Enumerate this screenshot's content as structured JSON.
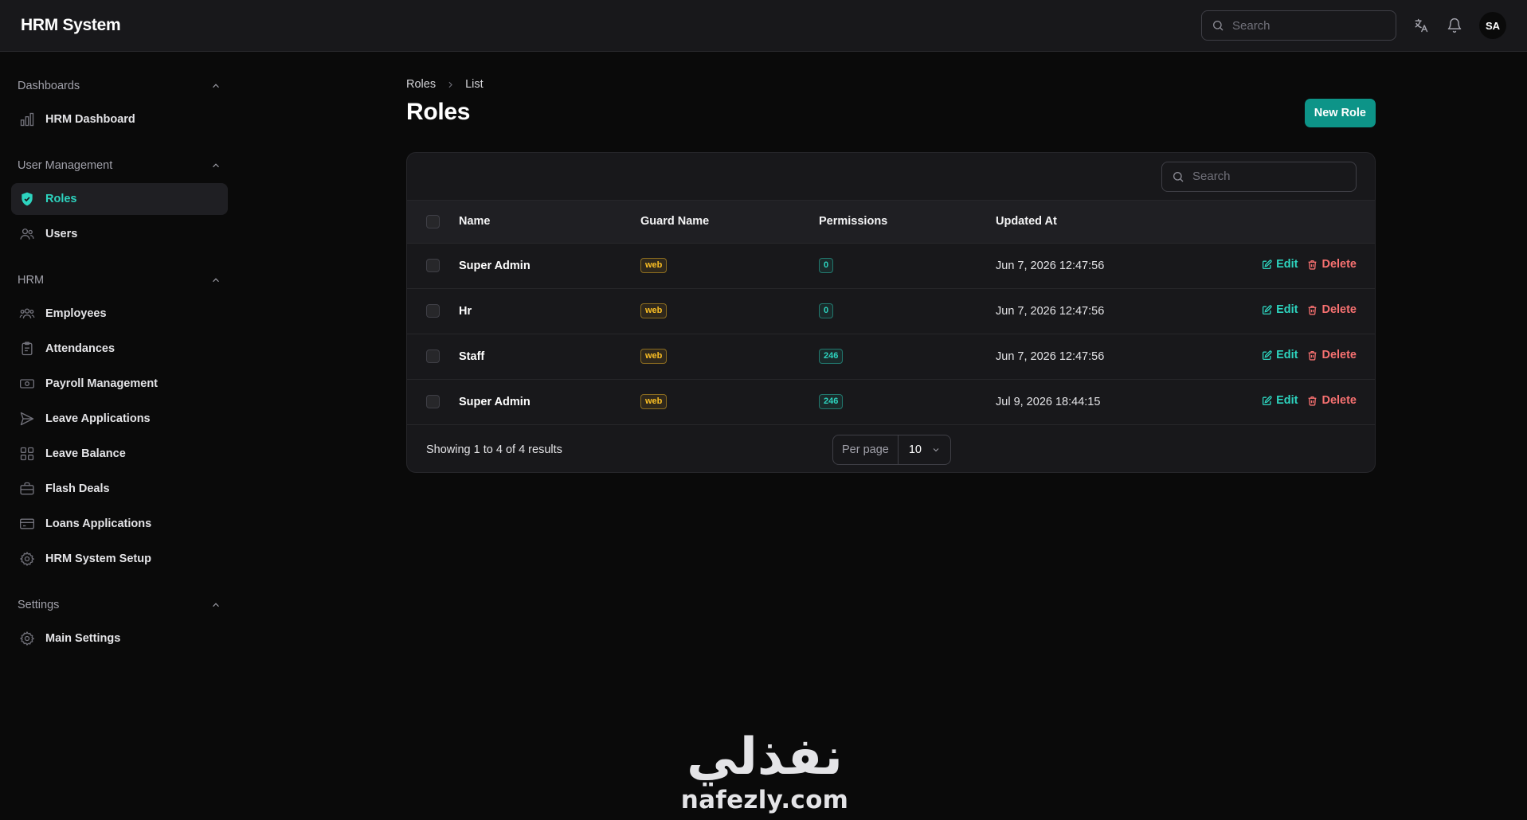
{
  "app": {
    "title": "HRM System"
  },
  "topbar": {
    "search_placeholder": "Search",
    "avatar_initials": "SA"
  },
  "sidebar": {
    "groups": [
      {
        "label": "Dashboards",
        "items": [
          {
            "label": "HRM Dashboard",
            "icon": "bar-chart-icon"
          }
        ]
      },
      {
        "label": "User Management",
        "items": [
          {
            "label": "Roles",
            "icon": "shield-check-icon",
            "active": true
          },
          {
            "label": "Users",
            "icon": "users-icon"
          }
        ]
      },
      {
        "label": "HRM",
        "items": [
          {
            "label": "Employees",
            "icon": "user-group-icon"
          },
          {
            "label": "Attendances",
            "icon": "clipboard-icon"
          },
          {
            "label": "Payroll Management",
            "icon": "banknote-icon"
          },
          {
            "label": "Leave Applications",
            "icon": "paper-plane-icon"
          },
          {
            "label": "Leave Balance",
            "icon": "grid-icon"
          },
          {
            "label": "Flash Deals",
            "icon": "briefcase-icon"
          },
          {
            "label": "Loans Applications",
            "icon": "credit-card-icon"
          },
          {
            "label": "HRM System Setup",
            "icon": "gear-icon"
          }
        ]
      },
      {
        "label": "Settings",
        "items": [
          {
            "label": "Main Settings",
            "icon": "gear-icon"
          }
        ]
      }
    ]
  },
  "main": {
    "breadcrumb": [
      "Roles",
      "List"
    ],
    "title": "Roles",
    "new_button": "New Role",
    "table": {
      "search_placeholder": "Search",
      "columns": [
        "Name",
        "Guard Name",
        "Permissions",
        "Updated At"
      ],
      "rows": [
        {
          "name": "Super Admin",
          "guard": "web",
          "permissions": "0",
          "updated": "Jun 7, 2026 12:47:56"
        },
        {
          "name": "Hr",
          "guard": "web",
          "permissions": "0",
          "updated": "Jun 7, 2026 12:47:56"
        },
        {
          "name": "Staff",
          "guard": "web",
          "permissions": "246",
          "updated": "Jun 7, 2026 12:47:56"
        },
        {
          "name": "Super Admin",
          "guard": "web",
          "permissions": "246",
          "updated": "Jul 9, 2026 18:44:15"
        }
      ],
      "edit_label": "Edit",
      "delete_label": "Delete",
      "showing": "Showing 1 to 4 of 4 results",
      "per_page_label": "Per page",
      "per_page_value": "10"
    }
  },
  "watermark": {
    "arabic": "نفذلي",
    "latin": "nafezly.com"
  },
  "colors": {
    "accent": "#0d9488",
    "accent_text": "#2dd4bf",
    "danger": "#f87171",
    "warning": "#fbbf24",
    "background": "#0a0a0a",
    "surface": "#18181b"
  }
}
